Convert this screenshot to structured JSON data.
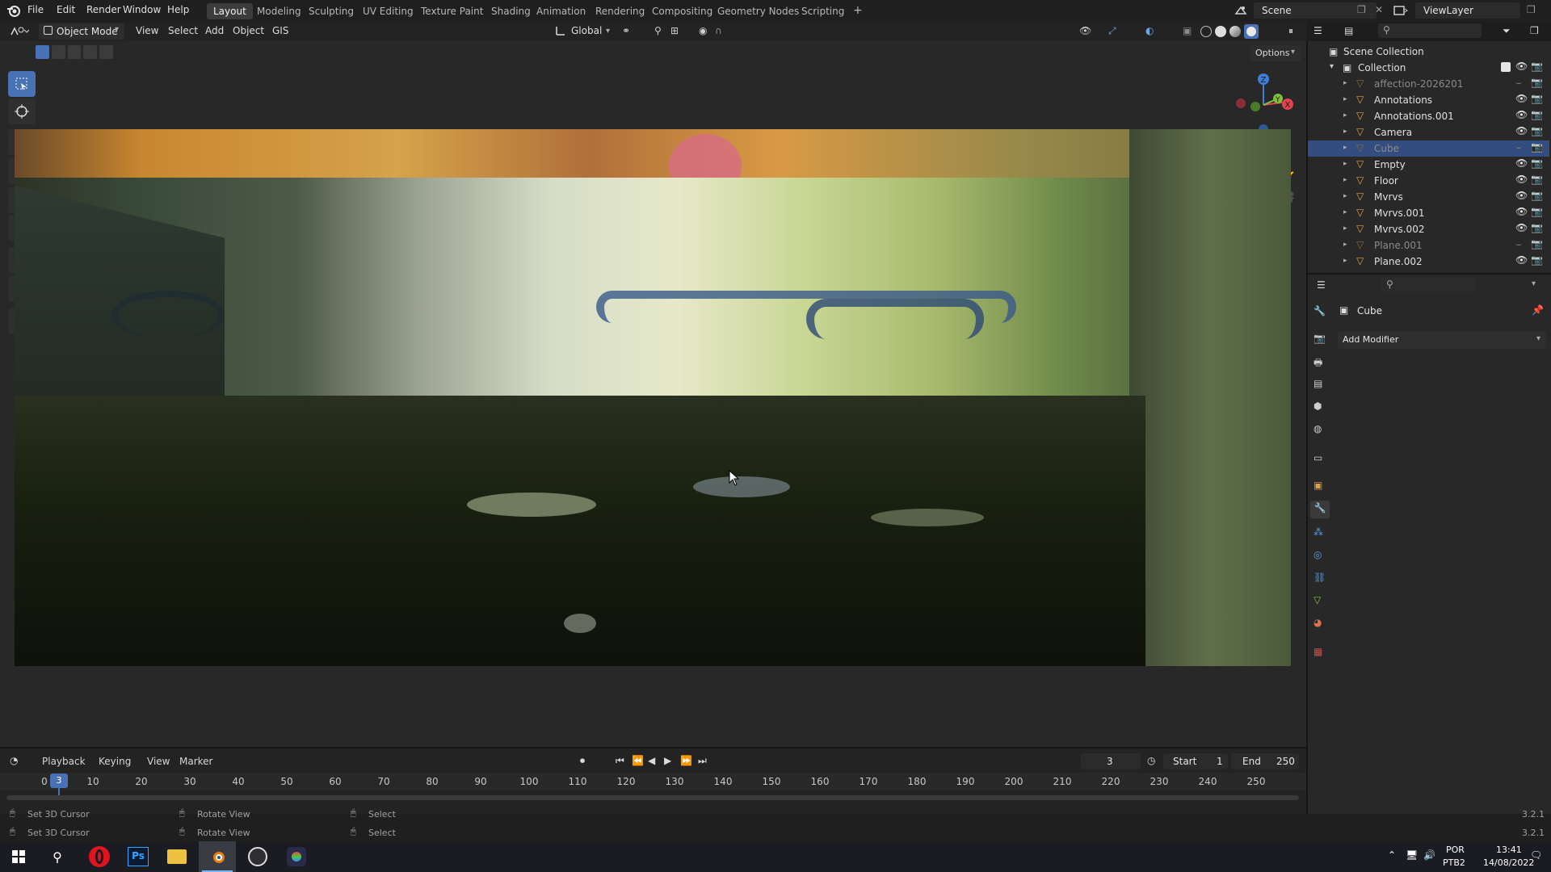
{
  "topbar": {
    "menus": [
      "File",
      "Edit",
      "Render",
      "Window",
      "Help"
    ],
    "workspaces": [
      "Layout",
      "Modeling",
      "Sculpting",
      "UV Editing",
      "Texture Paint",
      "Shading",
      "Animation",
      "Rendering",
      "Compositing",
      "Geometry Nodes",
      "Scripting"
    ],
    "active_workspace": "Layout",
    "add_tab": "+",
    "scene_name": "Scene",
    "view_layer": "ViewLayer"
  },
  "viewport_header": {
    "mode": "Object Mode",
    "menus": [
      "View",
      "Select",
      "Add",
      "Object",
      "GIS"
    ],
    "transform_orientation": "Global",
    "options_label": "Options"
  },
  "outliner": {
    "root": "Scene Collection",
    "collection": "Collection",
    "items": [
      {
        "name": "affection-2026201",
        "dim": true
      },
      {
        "name": "Annotations",
        "dim": false
      },
      {
        "name": "Annotations.001",
        "dim": false
      },
      {
        "name": "Camera",
        "dim": false
      },
      {
        "name": "Cube",
        "dim": true,
        "selected": true
      },
      {
        "name": "Empty",
        "dim": false
      },
      {
        "name": "Floor",
        "dim": false
      },
      {
        "name": "Mvrvs",
        "dim": false
      },
      {
        "name": "Mvrvs.001",
        "dim": false
      },
      {
        "name": "Mvrvs.002",
        "dim": false
      },
      {
        "name": "Plane.001",
        "dim": true
      },
      {
        "name": "Plane.002",
        "dim": false
      }
    ]
  },
  "properties": {
    "object_name": "Cube",
    "add_modifier": "Add Modifier"
  },
  "timeline": {
    "menus": [
      "Playback",
      "Keying",
      "View",
      "Marker"
    ],
    "current_frame": "3",
    "start_label": "Start",
    "start_value": "1",
    "end_label": "End",
    "end_value": "250",
    "ticks": [
      "0",
      "10",
      "20",
      "30",
      "40",
      "50",
      "60",
      "70",
      "80",
      "90",
      "100",
      "110",
      "120",
      "130",
      "140",
      "150",
      "160",
      "170",
      "180",
      "190",
      "200",
      "210",
      "220",
      "230",
      "240",
      "250"
    ],
    "playhead": "3"
  },
  "status": {
    "row1": [
      "Set 3D Cursor",
      "Rotate View",
      "Select"
    ],
    "row2": [
      "Set 3D Cursor",
      "Rotate View",
      "Select"
    ],
    "version1": "3.2.1",
    "version2": "3.2.1"
  },
  "taskbar": {
    "apps": [
      "windows-start",
      "search",
      "opera",
      "photoshop",
      "file-explorer",
      "blender",
      "obs",
      "davinci"
    ],
    "ps_label": "Ps",
    "lang1": "POR",
    "lang2": "PTB2",
    "time": "13:41",
    "date": "14/08/2022"
  },
  "colors": {
    "accent": "#4872b3",
    "selection": "#334d80",
    "axis_x": "#e0424f",
    "axis_y": "#7fbf3f",
    "axis_z": "#3f7fd6"
  }
}
